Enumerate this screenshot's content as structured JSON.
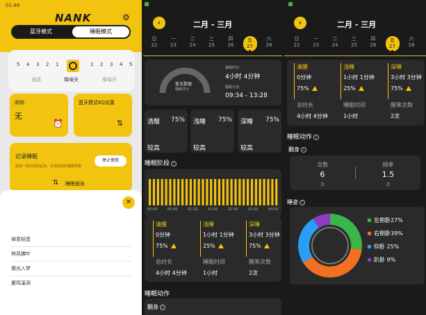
{
  "phone1": {
    "status_time": "01:46",
    "logo": "NANK",
    "tabs": [
      "蓝牙模式",
      "睡眠模式"
    ],
    "slider_ticks": [
      "5",
      "4",
      "3",
      "2",
      "1",
      "1",
      "2",
      "3",
      "4",
      "5"
    ],
    "slider_labels": [
      "通透",
      "降噪关",
      "降噪开"
    ],
    "alarm_title": "闹钟",
    "alarm_value": "无",
    "eq_title": "蓝牙模式EQ设置",
    "record_title": "记录睡眠",
    "record_desc": "连续一段时间的监测，并追踪您的睡眠质量",
    "stop_button": "停止使用",
    "report_label": "睡眠报告",
    "sheet_items": [
      "禅意轻音",
      "林风拂叶",
      "微光入梦",
      "夏鸣溪涧"
    ]
  },
  "phone2": {
    "title": "二月 - 三月",
    "week_days": [
      "日",
      "一",
      "二",
      "三",
      "四",
      "五",
      "六"
    ],
    "dates": [
      "22",
      "23",
      "24",
      "25",
      "26",
      "27",
      "28"
    ],
    "selected_index": 5,
    "gauge_label": "暂无数据",
    "gauge_sub": "睡眠评分",
    "sleep_time_label": "睡眠时间",
    "sleep_time_value": "4小时 4分钟",
    "sleep_plan_label": "睡眠计划",
    "sleep_plan_value": "09:34 - 13:28",
    "cards": [
      {
        "name": "清醒",
        "pct": "75%",
        "level": "较高"
      },
      {
        "name": "浅睡",
        "pct": "75%",
        "level": "较高"
      },
      {
        "name": "深睡",
        "pct": "75%",
        "level": "较高"
      }
    ],
    "stage_title": "睡眠阶段",
    "time_ticks": [
      "00:00",
      "00:40",
      "01:20",
      "02:00",
      "02:40",
      "03:20",
      "04:00"
    ],
    "stage_bars": 32,
    "stats": [
      {
        "name": "清醒",
        "dur": "0分钟",
        "pct": "75%"
      },
      {
        "name": "浅睡",
        "dur": "1小时 1分钟",
        "pct": "25%"
      },
      {
        "name": "深睡",
        "dur": "3小时 3分钟",
        "pct": "75%"
      }
    ],
    "totals": [
      {
        "label": "总时长",
        "value": "4小时 4分钟"
      },
      {
        "label": "睡眠时间",
        "value": "1小时"
      },
      {
        "label": "醒来次数",
        "value": "2次"
      }
    ],
    "action_title": "睡眠动作",
    "turn_title": "翻身"
  },
  "phone3": {
    "title": "二月 - 三月",
    "week_days": [
      "日",
      "一",
      "二",
      "三",
      "四",
      "五",
      "六"
    ],
    "dates": [
      "22",
      "23",
      "24",
      "25",
      "26",
      "27",
      "28"
    ],
    "selected_index": 5,
    "stats": [
      {
        "name": "清醒",
        "dur": "0分钟",
        "pct": "75%"
      },
      {
        "name": "浅睡",
        "dur": "1小时 1分钟",
        "pct": "25%"
      },
      {
        "name": "深睡",
        "dur": "3小时 3分钟",
        "pct": "75%"
      }
    ],
    "totals": [
      {
        "label": "总时长",
        "value": "4小时 4分钟"
      },
      {
        "label": "睡眠时间",
        "value": "1小时"
      },
      {
        "label": "醒来次数",
        "value": "2次"
      }
    ],
    "action_title": "睡眠动作",
    "turn_title": "翻身",
    "turn_count_label": "次数",
    "turn_count": "6",
    "turn_count_unit": "次",
    "turn_freq_label": "频率",
    "turn_freq": "1.5",
    "turn_freq_unit": "次",
    "posture_title": "睡姿"
  },
  "chart_data": {
    "type": "pie",
    "categories": [
      "左侧卧",
      "右侧卧",
      "仰卧",
      "趴卧"
    ],
    "values": [
      27,
      39,
      25,
      9
    ],
    "labels": [
      "左侧卧27%",
      "右侧卧39%",
      "仰卧 25%",
      "趴卧 9%"
    ],
    "colors": [
      "#3ab54a",
      "#f36f21",
      "#2a9df4",
      "#8e3cc4"
    ]
  },
  "colors": {
    "accent": "#f3c40f",
    "dark_bg": "#1a1a1a",
    "card_bg": "#2a2a2a"
  }
}
